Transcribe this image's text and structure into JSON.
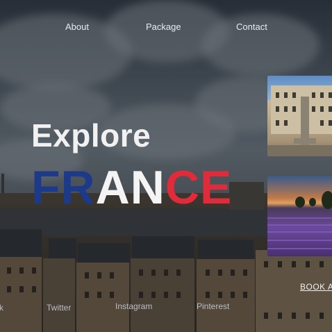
{
  "nav": {
    "items": [
      {
        "label": "About"
      },
      {
        "label": "Package"
      },
      {
        "label": "Contact"
      }
    ]
  },
  "hero": {
    "heading": "Explore",
    "country_letters": [
      {
        "text": "FR",
        "color": "#1d3a8a"
      },
      {
        "text": "AN",
        "color": "#f4f4f4"
      },
      {
        "text": "CE",
        "color": "#e12a3a"
      }
    ]
  },
  "cta": {
    "label": "BOOK A"
  },
  "social": {
    "items": [
      {
        "label": "k"
      },
      {
        "label": "Twitter"
      },
      {
        "label": "Instagram"
      },
      {
        "label": "Pinterest"
      }
    ]
  },
  "colors": {
    "flag_blue": "#1d3a8a",
    "flag_white": "#f4f4f4",
    "flag_red": "#e12a3a"
  }
}
